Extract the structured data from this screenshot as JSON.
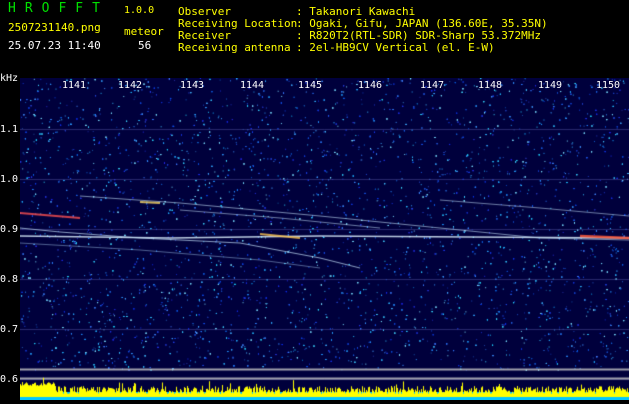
{
  "header": {
    "title": "HROFFT",
    "version": "1.0.0",
    "filename": "2507231140.png",
    "datetime": "25.07.23 11:40",
    "mode_label": "meteor",
    "count": "56",
    "info_labels": [
      "Observer",
      "Receiving Location",
      "Receiver",
      "Receiving antenna"
    ],
    "info_values": [
      ": Takanori Kawachi",
      ": Ogaki, Gifu, JAPAN (136.60E, 35.35N)",
      ": R820T2(RTL-SDR) SDR-Sharp 53.372MHz",
      ": 2el-HB9CV Vertical (el. E-W)"
    ]
  },
  "axis": {
    "unit": "kHz",
    "y_ticks": [
      "1.1",
      "1.0",
      "0.9",
      "0.8",
      "0.7",
      "0.6"
    ],
    "x_ticks": [
      "1141",
      "1142",
      "1143",
      "1144",
      "1145",
      "1146",
      "1147",
      "1148",
      "1149",
      "1150"
    ]
  },
  "colors": {
    "background": "#00003c",
    "header_green": "#00e000",
    "header_yellow": "#ffff00",
    "trace": "#ffffff",
    "signal_high": "#ff3030",
    "bottom_bar": "#ffff00",
    "bottom_base": "#00c8ff"
  }
}
